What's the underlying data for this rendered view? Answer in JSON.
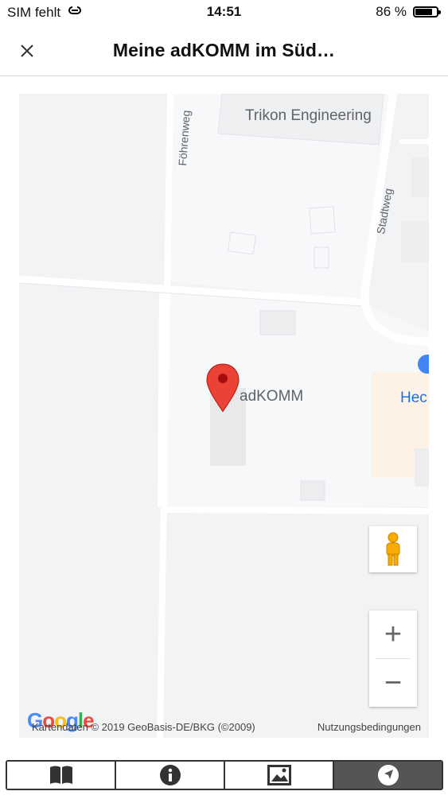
{
  "status_bar": {
    "carrier": "SIM fehlt",
    "time": "14:51",
    "battery_percent": "86 %",
    "battery_level": 0.86
  },
  "header": {
    "title": "Meine adKOMM im Süd…",
    "close_icon": "close-icon"
  },
  "map": {
    "places": {
      "trikon": "Trikon Engineering",
      "adkomm": "adKOMM",
      "partial_hec": "Hec"
    },
    "streets": {
      "foehrenweg": "Föhrenweg",
      "stadtweg": "Stadtweg"
    },
    "google_logo": "Google",
    "attribution": "Kartendaten © 2019 GeoBasis-DE/BKG (©2009)",
    "terms": "Nutzungsbedingungen",
    "zoom_in": "+",
    "zoom_out": "−",
    "colors": {
      "background": "#f2f3f5",
      "block_light": "#f8f9fa",
      "road": "#ffffff",
      "building": "#e8e9eb",
      "pin": "#ea4335",
      "commercial": "#fdf2e5",
      "poi_blue": "#4285f4"
    }
  },
  "tabbar": {
    "tabs": [
      {
        "name": "book-icon",
        "active": false
      },
      {
        "name": "info-icon",
        "active": false
      },
      {
        "name": "image-icon",
        "active": false
      },
      {
        "name": "navigation-icon",
        "active": true
      }
    ]
  }
}
